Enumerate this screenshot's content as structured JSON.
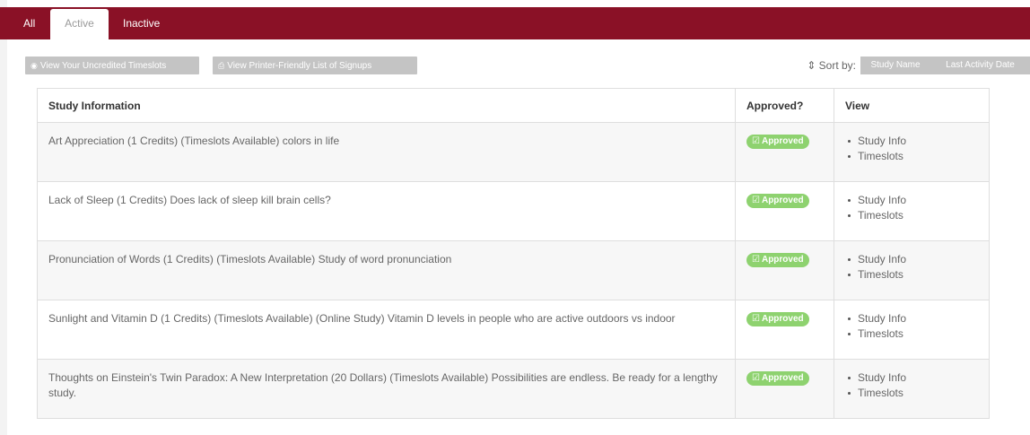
{
  "tabs": {
    "all": "All",
    "active": "Active",
    "inactive": "Inactive"
  },
  "toolbar": {
    "uncredited_label": "View Your Uncredited Timeslots",
    "printer_label": "View Printer-Friendly List of Signups",
    "sort_label": "Sort by:",
    "sort_study_name": "Study Name",
    "sort_last_activity": "Last Activity Date"
  },
  "table": {
    "headers": {
      "info": "Study Information",
      "approved": "Approved?",
      "view": "View"
    },
    "rows": [
      {
        "info": "Art Appreciation (1 Credits) (Timeslots Available) colors in life",
        "status": "Approved",
        "link1": "Study Info",
        "link2": "Timeslots"
      },
      {
        "info": "Lack of Sleep (1 Credits) Does lack of sleep kill brain cells?",
        "status": "Approved",
        "link1": "Study Info",
        "link2": "Timeslots"
      },
      {
        "info": "Pronunciation of Words (1 Credits) (Timeslots Available) Study of word pronunciation",
        "status": "Approved",
        "link1": "Study Info",
        "link2": "Timeslots"
      },
      {
        "info": "Sunlight and Vitamin D (1 Credits) (Timeslots Available) (Online Study) Vitamin D levels in people who are active outdoors vs indoor",
        "status": "Approved",
        "link1": "Study Info",
        "link2": "Timeslots"
      },
      {
        "info": "Thoughts on Einstein's Twin Paradox: A New Interpretation (20 Dollars) (Timeslots Available) Possibilities are endless. Be ready for a lengthy study.",
        "status": "Approved",
        "link1": "Study Info",
        "link2": "Timeslots"
      }
    ]
  },
  "icons": {
    "eye": "eye-icon",
    "printer": "printer-icon",
    "sort": "sort-icon",
    "check": "checkbox-check-icon"
  },
  "colors": {
    "brand": "#8a1126",
    "approved": "#8ed26f",
    "button_gray": "#c4c4c4"
  }
}
